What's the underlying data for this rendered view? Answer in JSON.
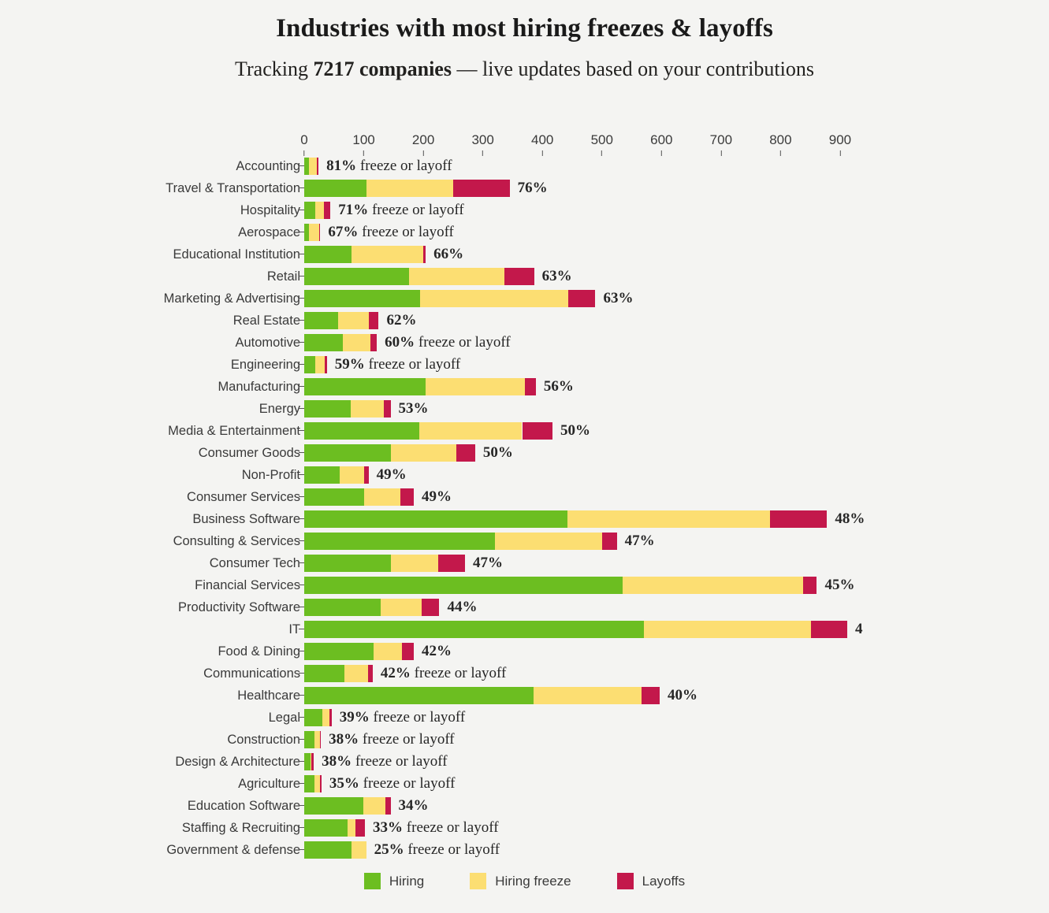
{
  "header": {
    "title": "Industries with most hiring freezes & layoffs",
    "subtitle_prefix": "Tracking ",
    "subtitle_strong": "7217 companies",
    "subtitle_suffix": " — live updates based on your contributions"
  },
  "colors": {
    "background": "#f4f4f2",
    "hiring": "#6cbe21",
    "hiring_freeze": "#fcde72",
    "layoffs": "#c3184b",
    "text": "#3a3a3a",
    "axis": "#555555"
  },
  "legend": {
    "position": "bottom-center",
    "items": [
      {
        "label": "Hiring",
        "color": "#6cbe21"
      },
      {
        "label": "Hiring freeze",
        "color": "#fcde72"
      },
      {
        "label": "Layoffs",
        "color": "#c3184b"
      }
    ]
  },
  "chart_data": {
    "type": "bar",
    "orientation": "horizontal",
    "stacked": true,
    "title": "Industries with most hiring freezes & layoffs",
    "subtitle": "Tracking 7217 companies — live updates based on your contributions",
    "xlabel": "",
    "ylabel": "",
    "xlim": [
      0,
      920
    ],
    "xticks": [
      0,
      100,
      200,
      300,
      400,
      500,
      600,
      700,
      800,
      900
    ],
    "xtick_labels": [
      "0",
      "100",
      "200",
      "300",
      "400",
      "500",
      "600",
      "700",
      "800",
      "900"
    ],
    "axis_position": "top",
    "grid": false,
    "series": [
      {
        "name": "Hiring",
        "color": "#6cbe21"
      },
      {
        "name": "Hiring freeze",
        "color": "#fcde72"
      },
      {
        "name": "Layoffs",
        "color": "#c3184b"
      }
    ],
    "categories": [
      "Accounting",
      "Travel & Transportation",
      "Hospitality",
      "Aerospace",
      "Educational Institution",
      "Retail",
      "Marketing & Advertising",
      "Real Estate",
      "Automotive",
      "Engineering",
      "Manufacturing",
      "Energy",
      "Media & Entertainment",
      "Consumer Goods",
      "Non-Profit",
      "Consumer Services",
      "Business Software",
      "Consulting & Services",
      "Consumer Tech",
      "Financial Services",
      "Productivity Software",
      "IT",
      "Food & Dining",
      "Communications",
      "Healthcare",
      "Legal",
      "Construction",
      "Design & Architecture",
      "Agriculture",
      "Education Software",
      "Staffing & Recruiting",
      "Government & defense"
    ],
    "rows": [
      {
        "category": "Accounting",
        "hiring": 8,
        "hiring_freeze": 13,
        "layoffs": 3,
        "pct": "81%",
        "note": " freeze or layoff"
      },
      {
        "category": "Travel & Transportation",
        "hiring": 105,
        "hiring_freeze": 145,
        "layoffs": 95,
        "pct": "76%",
        "note": ""
      },
      {
        "category": "Hospitality",
        "hiring": 18,
        "hiring_freeze": 15,
        "layoffs": 11,
        "pct": "71%",
        "note": " freeze or layoff"
      },
      {
        "category": "Aerospace",
        "hiring": 8,
        "hiring_freeze": 17,
        "layoffs": 2,
        "pct": "67%",
        "note": " freeze or layoff"
      },
      {
        "category": "Educational Institution",
        "hiring": 79,
        "hiring_freeze": 121,
        "layoffs": 4,
        "pct": "66%",
        "note": ""
      },
      {
        "category": "Retail",
        "hiring": 176,
        "hiring_freeze": 160,
        "layoffs": 50,
        "pct": "63%",
        "note": ""
      },
      {
        "category": "Marketing & Advertising",
        "hiring": 194,
        "hiring_freeze": 250,
        "layoffs": 45,
        "pct": "63%",
        "note": ""
      },
      {
        "category": "Real Estate",
        "hiring": 57,
        "hiring_freeze": 52,
        "layoffs": 16,
        "pct": "62%",
        "note": ""
      },
      {
        "category": "Automotive",
        "hiring": 65,
        "hiring_freeze": 46,
        "layoffs": 11,
        "pct": "60%",
        "note": " freeze or layoff"
      },
      {
        "category": "Engineering",
        "hiring": 18,
        "hiring_freeze": 17,
        "layoffs": 3,
        "pct": "59%",
        "note": " freeze or layoff"
      },
      {
        "category": "Manufacturing",
        "hiring": 204,
        "hiring_freeze": 166,
        "layoffs": 19,
        "pct": "56%",
        "note": ""
      },
      {
        "category": "Energy",
        "hiring": 78,
        "hiring_freeze": 56,
        "layoffs": 11,
        "pct": "53%",
        "note": ""
      },
      {
        "category": "Media & Entertainment",
        "hiring": 193,
        "hiring_freeze": 173,
        "layoffs": 51,
        "pct": "50%",
        "note": ""
      },
      {
        "category": "Consumer Goods",
        "hiring": 146,
        "hiring_freeze": 110,
        "layoffs": 31,
        "pct": "50%",
        "note": ""
      },
      {
        "category": "Non-Profit",
        "hiring": 60,
        "hiring_freeze": 41,
        "layoffs": 7,
        "pct": "49%",
        "note": ""
      },
      {
        "category": "Consumer Services",
        "hiring": 101,
        "hiring_freeze": 61,
        "layoffs": 22,
        "pct": "49%",
        "note": ""
      },
      {
        "category": "Business Software",
        "hiring": 442,
        "hiring_freeze": 340,
        "layoffs": 96,
        "pct": "48%",
        "note": ""
      },
      {
        "category": "Consulting & Services",
        "hiring": 320,
        "hiring_freeze": 180,
        "layoffs": 25,
        "pct": "47%",
        "note": ""
      },
      {
        "category": "Consumer Tech",
        "hiring": 145,
        "hiring_freeze": 80,
        "layoffs": 45,
        "pct": "47%",
        "note": ""
      },
      {
        "category": "Financial Services",
        "hiring": 535,
        "hiring_freeze": 303,
        "layoffs": 23,
        "pct": "45%",
        "note": ""
      },
      {
        "category": "Productivity Software",
        "hiring": 129,
        "hiring_freeze": 68,
        "layoffs": 30,
        "pct": "44%",
        "note": ""
      },
      {
        "category": "IT",
        "hiring": 570,
        "hiring_freeze": 281,
        "layoffs": 61,
        "pct": "4",
        "note": ""
      },
      {
        "category": "Food & Dining",
        "hiring": 116,
        "hiring_freeze": 48,
        "layoffs": 20,
        "pct": "42%",
        "note": ""
      },
      {
        "category": "Communications",
        "hiring": 67,
        "hiring_freeze": 40,
        "layoffs": 8,
        "pct": "42%",
        "note": " freeze or layoff"
      },
      {
        "category": "Healthcare",
        "hiring": 385,
        "hiring_freeze": 182,
        "layoffs": 30,
        "pct": "40%",
        "note": ""
      },
      {
        "category": "Legal",
        "hiring": 30,
        "hiring_freeze": 13,
        "layoffs": 3,
        "pct": "39%",
        "note": " freeze or layoff"
      },
      {
        "category": "Construction",
        "hiring": 17,
        "hiring_freeze": 9,
        "layoffs": 2,
        "pct": "38%",
        "note": " freeze or layoff"
      },
      {
        "category": "Design & Architecture",
        "hiring": 10,
        "hiring_freeze": 2,
        "layoffs": 4,
        "pct": "38%",
        "note": " freeze or layoff"
      },
      {
        "category": "Agriculture",
        "hiring": 17,
        "hiring_freeze": 10,
        "layoffs": 2,
        "pct": "35%",
        "note": " freeze or layoff"
      },
      {
        "category": "Education Software",
        "hiring": 99,
        "hiring_freeze": 37,
        "layoffs": 9,
        "pct": "34%",
        "note": ""
      },
      {
        "category": "Staffing & Recruiting",
        "hiring": 73,
        "hiring_freeze": 13,
        "layoffs": 16,
        "pct": "33%",
        "note": " freeze or layoff"
      },
      {
        "category": "Government & defense",
        "hiring": 80,
        "hiring_freeze": 24,
        "layoffs": 0,
        "pct": "25%",
        "note": " freeze or layoff"
      }
    ]
  }
}
